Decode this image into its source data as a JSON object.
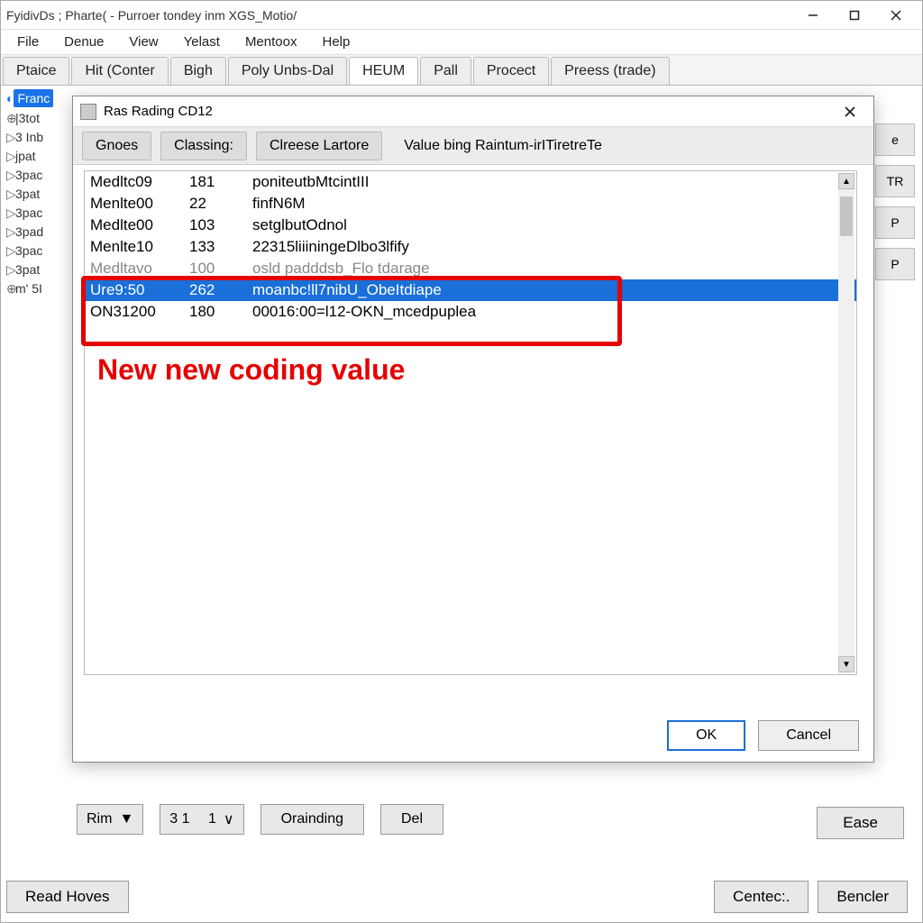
{
  "window": {
    "title": "FyidivDs ; Pharte( - Purroer tondey inm XGS_Motio/"
  },
  "menu": {
    "items": [
      "File",
      "Denue",
      "View",
      "Yelast",
      "Mentoox",
      "Help"
    ]
  },
  "tabs": {
    "items": [
      "Ptaice",
      "Hit (Conter",
      "Bigh",
      "Poly Unbs-Dal",
      "HEUM",
      "Pall",
      "Procect",
      "Preess (trade)"
    ],
    "active_index": 4
  },
  "sidebar": {
    "selected": "Franc",
    "nodes": [
      "|3tot",
      "3 Inb",
      "jpat",
      "3pac",
      "3pat",
      "3pac",
      "3pad",
      "3pac",
      "3pat"
    ],
    "last": "m' 5I"
  },
  "right_buttons": [
    "e",
    "TR",
    "P",
    "P"
  ],
  "dialog": {
    "title": "Ras Rading CD12",
    "tabs": [
      "Gnoes",
      "Classing:",
      "Clreese Lartore",
      "Value bing Raintum-irITiretreTe"
    ],
    "rows": [
      {
        "c1": "Medltc09",
        "c2": "181",
        "c3": "poniteutbMtcintIII"
      },
      {
        "c1": "Menlte00",
        "c2": "22",
        "c3": "finfN6M"
      },
      {
        "c1": "Medlte00",
        "c2": "103",
        "c3": "setglbutOdnol"
      },
      {
        "c1": "Menlte10",
        "c2": "133",
        "c3": "22315liiiningeDlbo3lfify"
      },
      {
        "c1": "Medltavo",
        "c2": "100",
        "c3": "osld padddsb_Flo tdarage"
      },
      {
        "c1": "Ure9:50",
        "c2": "262",
        "c3": "moanbc!ll7nibU_ObeItdiape"
      },
      {
        "c1": "ON31200",
        "c2": "180",
        "c3": "00016:00=l12-OKN_mcedpuplea"
      }
    ],
    "ok": "OK",
    "cancel": "Cancel"
  },
  "bottom": {
    "rim": "Rim",
    "val1": "3 1",
    "val2": "1",
    "btn1": "Orainding",
    "btn2": "Del"
  },
  "ease": "Ease",
  "footer": {
    "b1": "Read Hoves",
    "b2": "Centec:.",
    "b3": "Bencler"
  },
  "annotation": "New new coding value"
}
